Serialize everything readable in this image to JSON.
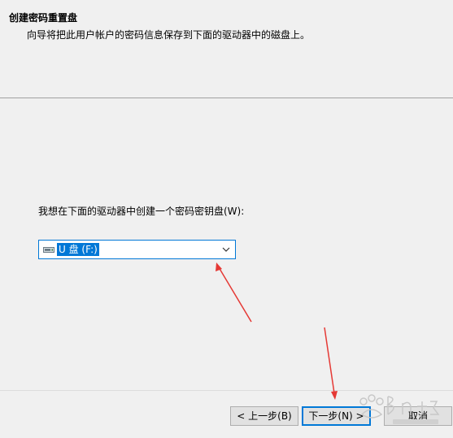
{
  "header": {
    "title": "创建密码重置盘",
    "subtitle": "向导将把此用户帐户的密码信息保存到下面的驱动器中的磁盘上。"
  },
  "main": {
    "prompt": "我想在下面的驱动器中创建一个密码密钥盘(W):",
    "drive_select": {
      "selected": "U 盘 (F:)",
      "icon": "usb-drive-icon"
    }
  },
  "buttons": {
    "back": "< 上一步(B)",
    "next": "下一步(N) >",
    "cancel": "取消"
  },
  "colors": {
    "accent": "#0078d7",
    "annotation_arrow": "#e53935"
  }
}
